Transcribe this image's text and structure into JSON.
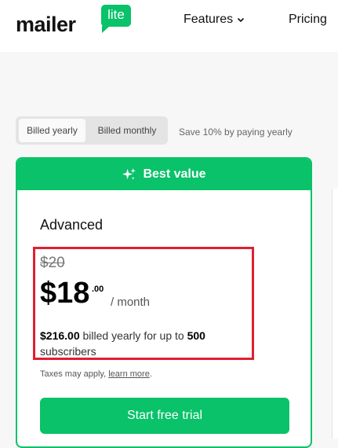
{
  "header": {
    "logo": {
      "text": "mailer",
      "badge": "lite"
    },
    "nav": {
      "features": "Features",
      "pricing": "Pricing"
    }
  },
  "billing": {
    "options": [
      "Billed yearly",
      "Billed monthly"
    ],
    "selected": "Billed yearly",
    "note": "Save 10% by paying yearly"
  },
  "plan": {
    "banner": "Best value",
    "name": "Advanced",
    "old_price": "$20",
    "price": "$18",
    "price_cents": ".00",
    "period": "/ month",
    "billed_amount": "$216.00",
    "billed_text": " billed yearly for up to ",
    "subscriber_count": "500",
    "subscriber_label": "subscribers",
    "taxes_text": "Taxes may apply, ",
    "learn_more": "learn more",
    "taxes_end": ".",
    "cta": "Start free trial"
  },
  "colors": {
    "brand_green": "#09c269",
    "highlight_red": "#e02030"
  },
  "icons": [
    "chevron-down-icon",
    "sparkle-icon"
  ]
}
